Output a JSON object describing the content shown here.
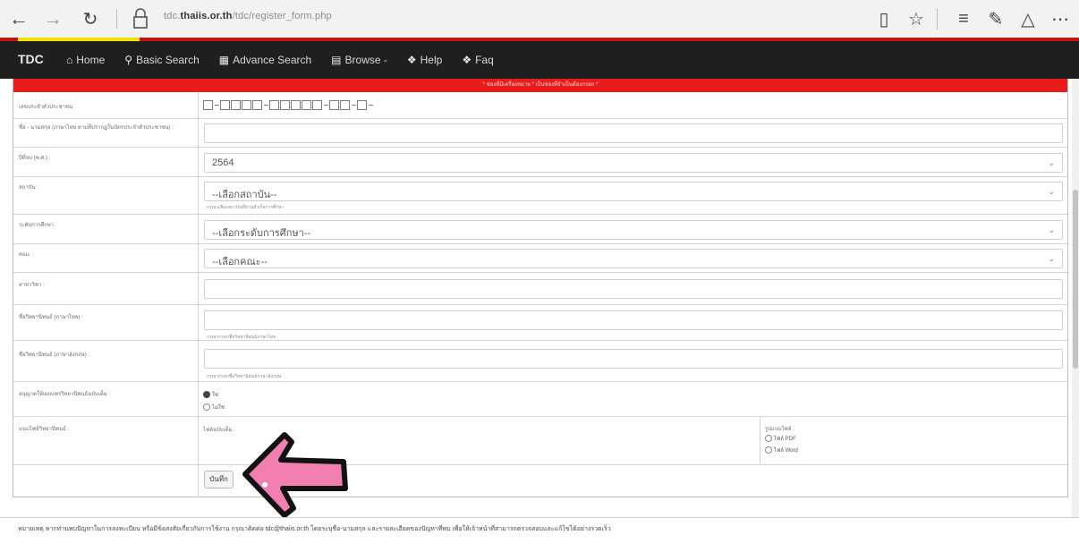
{
  "browser": {
    "url_prefix": "tdc.",
    "url_domain": "thaiis.or.th",
    "url_path": "/tdc/register_form.php"
  },
  "navbar": {
    "brand": "TDC",
    "items": [
      {
        "label": "Home"
      },
      {
        "label": "Basic Search"
      },
      {
        "label": "Advance Search"
      },
      {
        "label": "Browse -"
      },
      {
        "label": "Help"
      },
      {
        "label": "Faq"
      }
    ]
  },
  "form": {
    "banner": "* ช่องที่มีเครื่องหมาย * เป็นช่องที่จำเป็นต้องกรอก *",
    "rows": {
      "id_card": {
        "label": "เลขประจำตัวประชาชน :"
      },
      "name": {
        "label": "ชื่อ - นามสกุล (ภาษาไทย ตามที่ปรากฏในบัตรประจำตัวประชาชน) :"
      },
      "year": {
        "label": "ปีที่จบ (พ.ศ.) :",
        "value": "2564"
      },
      "university": {
        "label": "สถาบัน :",
        "value": "--เลือกสถาบัน--",
        "helper": "กรุณาเลือกสถาบันที่ท่านสำเร็จการศึกษา"
      },
      "degree": {
        "label": "ระดับการศึกษา :",
        "value": "--เลือกระดับการศึกษา--"
      },
      "faculty": {
        "label": "คณะ :",
        "value": "--เลือกคณะ--"
      },
      "major": {
        "label": "สาขาวิชา :"
      },
      "thesis_th": {
        "label": "ชื่อวิทยานิพนธ์ (ภาษาไทย) :",
        "helper": "กรุณากรอกชื่อวิทยานิพนธ์ภาษาไทย"
      },
      "thesis_en": {
        "label": "ชื่อวิทยานิพนธ์ (ภาษาอังกฤษ) :",
        "helper": "กรุณากรอกชื่อวิทยานิพนธ์ภาษาอังกฤษ"
      },
      "fulltext": {
        "label": "อนุญาตให้เผยแพร่วิทยานิพนธ์ฉบับเต็ม :",
        "options": [
          "ใช่",
          "ไม่ใช่"
        ]
      },
      "upload": {
        "label": "แนบไฟล์วิทยานิพนธ์ :",
        "left_text": "ไฟล์ฉบับเต็ม :",
        "right_title": "รูปแบบไฟล์ :",
        "right_options": [
          "ไฟล์ PDF",
          "ไฟล์ Word"
        ]
      }
    },
    "save_label": "บันทึก"
  },
  "footer": {
    "text": "หมายเหตุ หากท่านพบปัญหาในการลงทะเบียน หรือมีข้อสงสัยเกี่ยวกับการใช้งาน กรุณาติดต่อ tdc@thaiis.or.th โดยระบุชื่อ-นามสกุล และรายละเอียดของปัญหาที่พบ เพื่อให้เจ้าหน้าที่สามารถตรวจสอบและแก้ไขได้อย่างรวดเร็ว"
  }
}
